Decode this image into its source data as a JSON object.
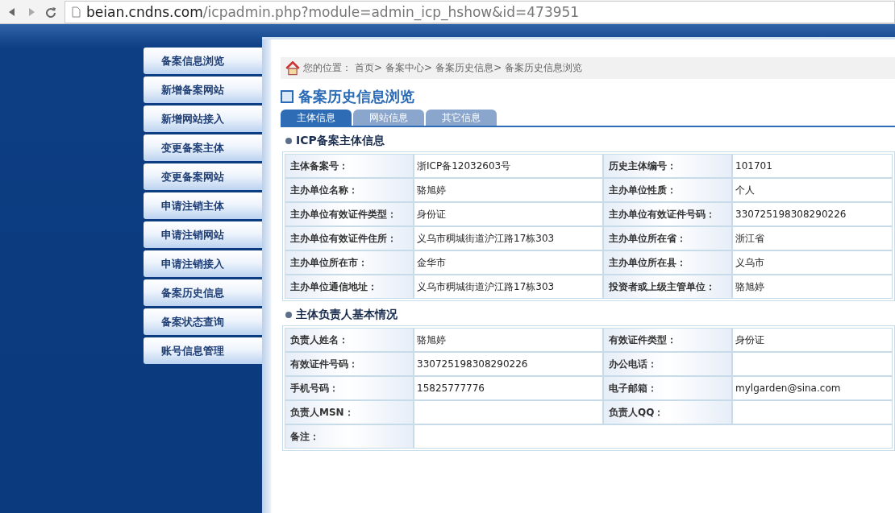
{
  "browser": {
    "url_host": "beian.cndns.com",
    "url_path": "/icpadmin.php?module=admin_icp_hshow&id=473951"
  },
  "sidebar": {
    "items": [
      {
        "label": "备案信息浏览"
      },
      {
        "label": "新增备案网站"
      },
      {
        "label": "新增网站接入"
      },
      {
        "label": "变更备案主体"
      },
      {
        "label": "变更备案网站"
      },
      {
        "label": "申请注销主体"
      },
      {
        "label": "申请注销网站"
      },
      {
        "label": "申请注销接入"
      },
      {
        "label": "备案历史信息"
      },
      {
        "label": "备案状态查询"
      },
      {
        "label": "账号信息管理"
      }
    ]
  },
  "breadcrumb": {
    "prefix": "您的位置：",
    "items": [
      "首页>",
      "备案中心>",
      "备案历史信息>",
      "备案历史信息浏览"
    ]
  },
  "title": "备案历史信息浏览",
  "tabs": [
    {
      "label": "主体信息",
      "selected": true
    },
    {
      "label": "网站信息",
      "selected": false
    },
    {
      "label": "其它信息",
      "selected": false
    }
  ],
  "sections": [
    {
      "title": "ICP备案主体信息",
      "rows": [
        [
          {
            "label": "主体备案号：",
            "value": "浙ICP备12032603号"
          },
          {
            "label": "历史主体编号：",
            "value": "101701"
          }
        ],
        [
          {
            "label": "主办单位名称：",
            "value": "骆旭婷"
          },
          {
            "label": "主办单位性质：",
            "value": "个人"
          }
        ],
        [
          {
            "label": "主办单位有效证件类型：",
            "value": "身份证"
          },
          {
            "label": "主办单位有效证件号码：",
            "value": "330725198308290226"
          }
        ],
        [
          {
            "label": "主办单位有效证件住所：",
            "value": "义乌市稠城街道沪江路17栋303"
          },
          {
            "label": "主办单位所在省：",
            "value": "浙江省"
          }
        ],
        [
          {
            "label": "主办单位所在市：",
            "value": "金华市"
          },
          {
            "label": "主办单位所在县：",
            "value": "义乌市"
          }
        ],
        [
          {
            "label": "主办单位通信地址：",
            "value": "义乌市稠城街道沪江路17栋303"
          },
          {
            "label": "投资者或上级主管单位：",
            "value": "骆旭婷"
          }
        ]
      ]
    },
    {
      "title": "主体负责人基本情况",
      "rows": [
        [
          {
            "label": "负责人姓名：",
            "value": "骆旭婷"
          },
          {
            "label": "有效证件类型：",
            "value": "身份证"
          }
        ],
        [
          {
            "label": "有效证件号码：",
            "value": "330725198308290226"
          },
          {
            "label": "办公电话："
          }
        ],
        [
          {
            "label": "手机号码：",
            "value": "15825777776"
          },
          {
            "label": "电子邮箱：",
            "value": "mylgarden@sina.com"
          }
        ],
        [
          {
            "label": "负责人MSN："
          },
          {
            "label": "负责人QQ："
          }
        ],
        [
          {
            "label": "备注："
          }
        ]
      ]
    }
  ]
}
